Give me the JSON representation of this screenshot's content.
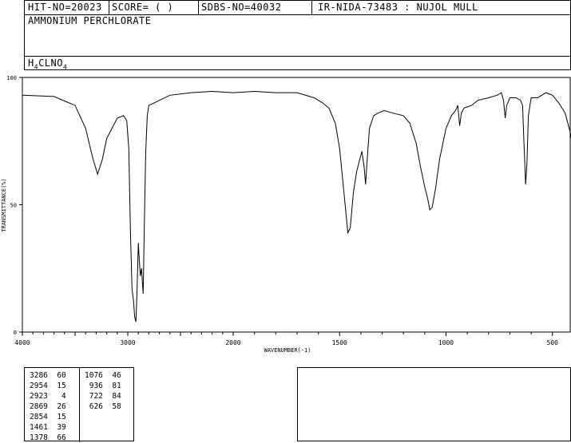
{
  "header": {
    "hit_no": "HIT-NO=20023",
    "score": "SCORE=  (   )",
    "sdbs_no": "SDBS-NO=40032",
    "ir_nida": "IR-NIDA-73483 : NUJOL MULL",
    "compound_name": "AMMONIUM PERCHLORATE",
    "formula_parts": [
      "H",
      "4",
      "CLNO",
      "4"
    ]
  },
  "chart_data": {
    "type": "line",
    "xlabel": "WAVENUMBER(-1)",
    "ylabel": "TRANSMITTANCE(%)",
    "xlim": [
      4000,
      400
    ],
    "ylim": [
      0,
      100
    ],
    "x_scale_break": 2000,
    "xticks": [
      4000,
      3000,
      2000,
      1500,
      1000,
      500
    ],
    "yticks": [
      0,
      50,
      100
    ],
    "ytick_labels": [
      "0",
      "50",
      "100"
    ],
    "color": "#000000",
    "series": [
      {
        "x": [
          4000,
          3700,
          3500,
          3400,
          3330,
          3286,
          3240,
          3200,
          3100,
          3040,
          3010,
          2990,
          2975,
          2960,
          2954,
          2945,
          2935,
          2923,
          2912,
          2900,
          2890,
          2880,
          2869,
          2862,
          2854,
          2845,
          2830,
          2815,
          2800,
          2750,
          2700,
          2600,
          2400,
          2200,
          2000,
          1900,
          1800,
          1700,
          1620,
          1580,
          1550,
          1520,
          1500,
          1480,
          1461,
          1450,
          1435,
          1420,
          1405,
          1395,
          1385,
          1378,
          1372,
          1360,
          1340,
          1320,
          1290,
          1250,
          1200,
          1170,
          1140,
          1120,
          1100,
          1085,
          1076,
          1065,
          1050,
          1030,
          1000,
          975,
          955,
          945,
          936,
          928,
          915,
          880,
          850,
          800,
          760,
          740,
          730,
          722,
          715,
          700,
          670,
          650,
          640,
          634,
          626,
          620,
          613,
          600,
          570,
          550,
          530,
          500,
          470,
          440,
          415,
          400
        ],
        "y": [
          93,
          92.5,
          89,
          80,
          68,
          62,
          68,
          76,
          84,
          85,
          83,
          72,
          40,
          17,
          15,
          12,
          6,
          4,
          16,
          35,
          28,
          22,
          25,
          20,
          15,
          38,
          70,
          85,
          89,
          90,
          91,
          93,
          94,
          94.5,
          94,
          94.5,
          94,
          94,
          92,
          90,
          88,
          82,
          72,
          55,
          39,
          41,
          55,
          63,
          68,
          71,
          65,
          58,
          66,
          80,
          85,
          86,
          87,
          86,
          85,
          82,
          74,
          65,
          57,
          52,
          48,
          49,
          56,
          68,
          80,
          85,
          87,
          89,
          81,
          86,
          88,
          89,
          91,
          92,
          93,
          94,
          91,
          84,
          89,
          92,
          92,
          91,
          89,
          75,
          58,
          66,
          85,
          92,
          92,
          93,
          94,
          93,
          90,
          86,
          78,
          70
        ]
      }
    ]
  },
  "peak_table": {
    "col1": [
      [
        "3286",
        "60"
      ],
      [
        "2954",
        "15"
      ],
      [
        "2923",
        "4"
      ],
      [
        "2869",
        "26"
      ],
      [
        "2854",
        "15"
      ],
      [
        "1461",
        "39"
      ],
      [
        "1378",
        "66"
      ]
    ],
    "col2": [
      [
        "1076",
        "46"
      ],
      [
        "936",
        "81"
      ],
      [
        "722",
        "84"
      ],
      [
        "626",
        "58"
      ]
    ]
  }
}
